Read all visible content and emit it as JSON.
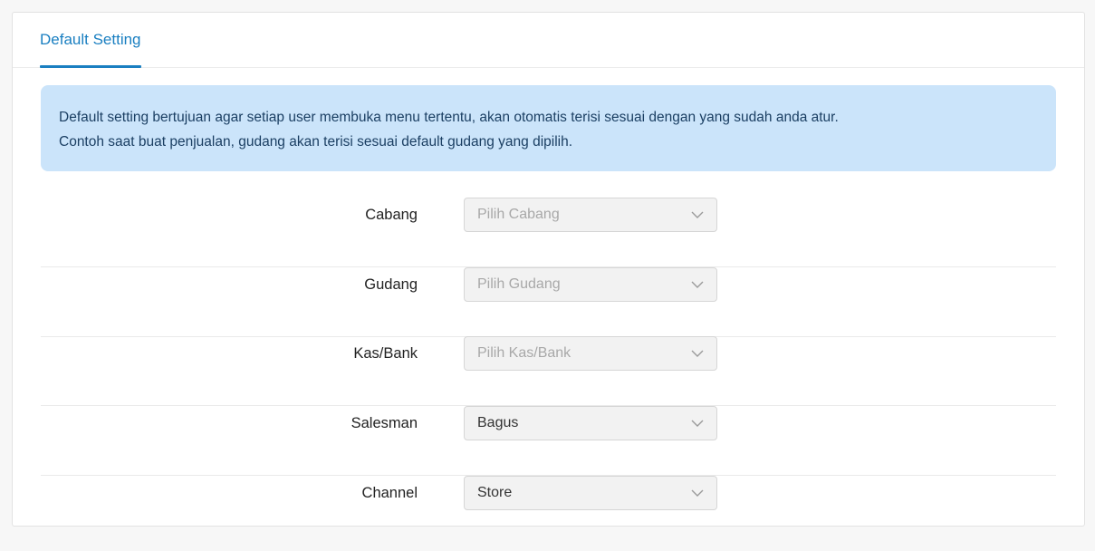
{
  "tabs": [
    {
      "label": "Default Setting",
      "active": true
    }
  ],
  "info": {
    "line1": "Default setting bertujuan agar setiap user membuka menu tertentu, akan otomatis terisi sesuai dengan yang sudah anda atur.",
    "line2": "Contoh saat buat penjualan, gudang akan terisi sesuai default gudang yang dipilih."
  },
  "fields": [
    {
      "label": "Cabang",
      "value": "",
      "placeholder": "Pilih Cabang"
    },
    {
      "label": "Gudang",
      "value": "",
      "placeholder": "Pilih Gudang"
    },
    {
      "label": "Kas/Bank",
      "value": "",
      "placeholder": "Pilih Kas/Bank"
    },
    {
      "label": "Salesman",
      "value": "Bagus",
      "placeholder": ""
    },
    {
      "label": "Channel",
      "value": "Store",
      "placeholder": ""
    }
  ],
  "icons": {
    "select_arrow": "chevron-down-icon"
  },
  "colors": {
    "accent": "#1a7fc1",
    "info_background": "#cbe4fa",
    "info_text": "#1b3f63"
  }
}
